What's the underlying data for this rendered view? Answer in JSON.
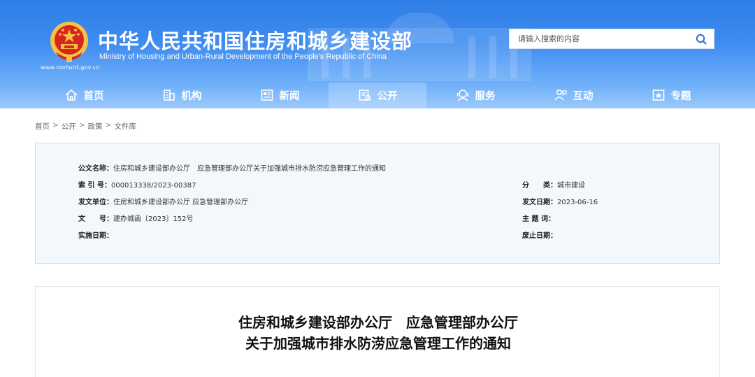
{
  "header": {
    "title": "中华人民共和国住房和城乡建设部",
    "subtitle": "Ministry of Housing and Urban-Rural Development of the People's Republic of China",
    "site_url": "www.mohurd.gov.cn",
    "logo_icon": "national-emblem-icon",
    "colors": {
      "header_blue": "#3e8cf0",
      "emblem_red": "#d7261e",
      "emblem_gold": "#f5c242"
    }
  },
  "search": {
    "placeholder": "请输入搜索的内容",
    "icon": "search-icon"
  },
  "nav": {
    "items": [
      {
        "label": "首页",
        "icon": "home-icon"
      },
      {
        "label": "机构",
        "icon": "building-icon"
      },
      {
        "label": "新闻",
        "icon": "news-icon"
      },
      {
        "label": "公开",
        "icon": "public-info-icon"
      },
      {
        "label": "服务",
        "icon": "service-icon"
      },
      {
        "label": "互动",
        "icon": "interaction-icon"
      },
      {
        "label": "专题",
        "icon": "topic-icon"
      }
    ],
    "active": "公开"
  },
  "breadcrumb": {
    "items": [
      "首页",
      "公开",
      "政策",
      "文件库"
    ],
    "separator": ">"
  },
  "doc_info": {
    "name_label": "公文名称：",
    "name_value": "住房和城乡建设部办公厅　应急管理部办公厅关于加强城市排水防涝应急管理工作的通知",
    "index_label": "索 引 号：",
    "index_value": "000013338/2023-00387",
    "category_label": "分　　类：",
    "category_value": "城市建设",
    "issuer_label": "发文单位：",
    "issuer_value": "住房和城乡建设部办公厅 应急管理部办公厅",
    "date_label": "发文日期：",
    "date_value": "2023-06-16",
    "docno_label": "文　　号：",
    "docno_value": "建办城函〔2023〕152号",
    "keywords_label": "主 题 词：",
    "keywords_value": "",
    "effective_label": "实施日期：",
    "effective_value": "",
    "expiry_label": "废止日期：",
    "expiry_value": ""
  },
  "article": {
    "title_line1": "住房和城乡建设部办公厅　应急管理部办公厅",
    "title_line2": "关于加强城市排水防涝应急管理工作的通知"
  }
}
